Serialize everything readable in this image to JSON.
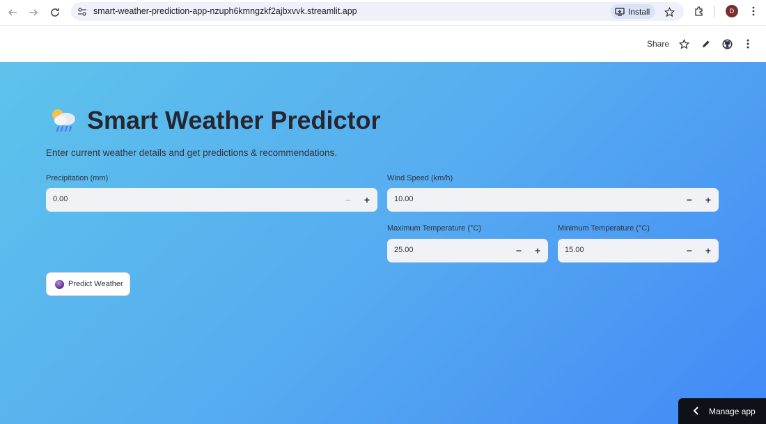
{
  "browser": {
    "url": "smart-weather-prediction-app-nzuph6kmngzkf2ajbxvvk.streamlit.app",
    "install_label": "Install",
    "profile_initial": "D"
  },
  "toolbar": {
    "share_label": "Share"
  },
  "app": {
    "title": "Smart Weather Predictor",
    "subtitle": "Enter current weather details and get predictions & recommendations.",
    "fields": {
      "precipitation": {
        "label": "Precipitation (mm)",
        "value": "0.00"
      },
      "wind_speed": {
        "label": "Wind Speed (km/h)",
        "value": "10.00"
      },
      "max_temp": {
        "label": "Maximum Temperature (°C)",
        "value": "25.00"
      },
      "min_temp": {
        "label": "Minimum Temperature (°C)",
        "value": "15.00"
      }
    },
    "predict_button": "Predict Weather",
    "manage_app": "Manage app"
  },
  "icons": {
    "back": "back-arrow-icon",
    "forward": "forward-arrow-icon",
    "reload": "reload-icon",
    "site_info": "site-info-icon",
    "bookmark": "star-icon",
    "extensions": "puzzle-icon",
    "menu": "kebab-menu-icon",
    "edit": "pencil-icon",
    "github": "github-icon",
    "title_emoji": "rain-cloud-icon",
    "predict_emoji": "crystal-ball-icon"
  },
  "colors": {
    "gradient_start": "#5ec3eb",
    "gradient_end": "#4289f6",
    "input_bg": "#f0f2f6",
    "text": "#262730"
  }
}
